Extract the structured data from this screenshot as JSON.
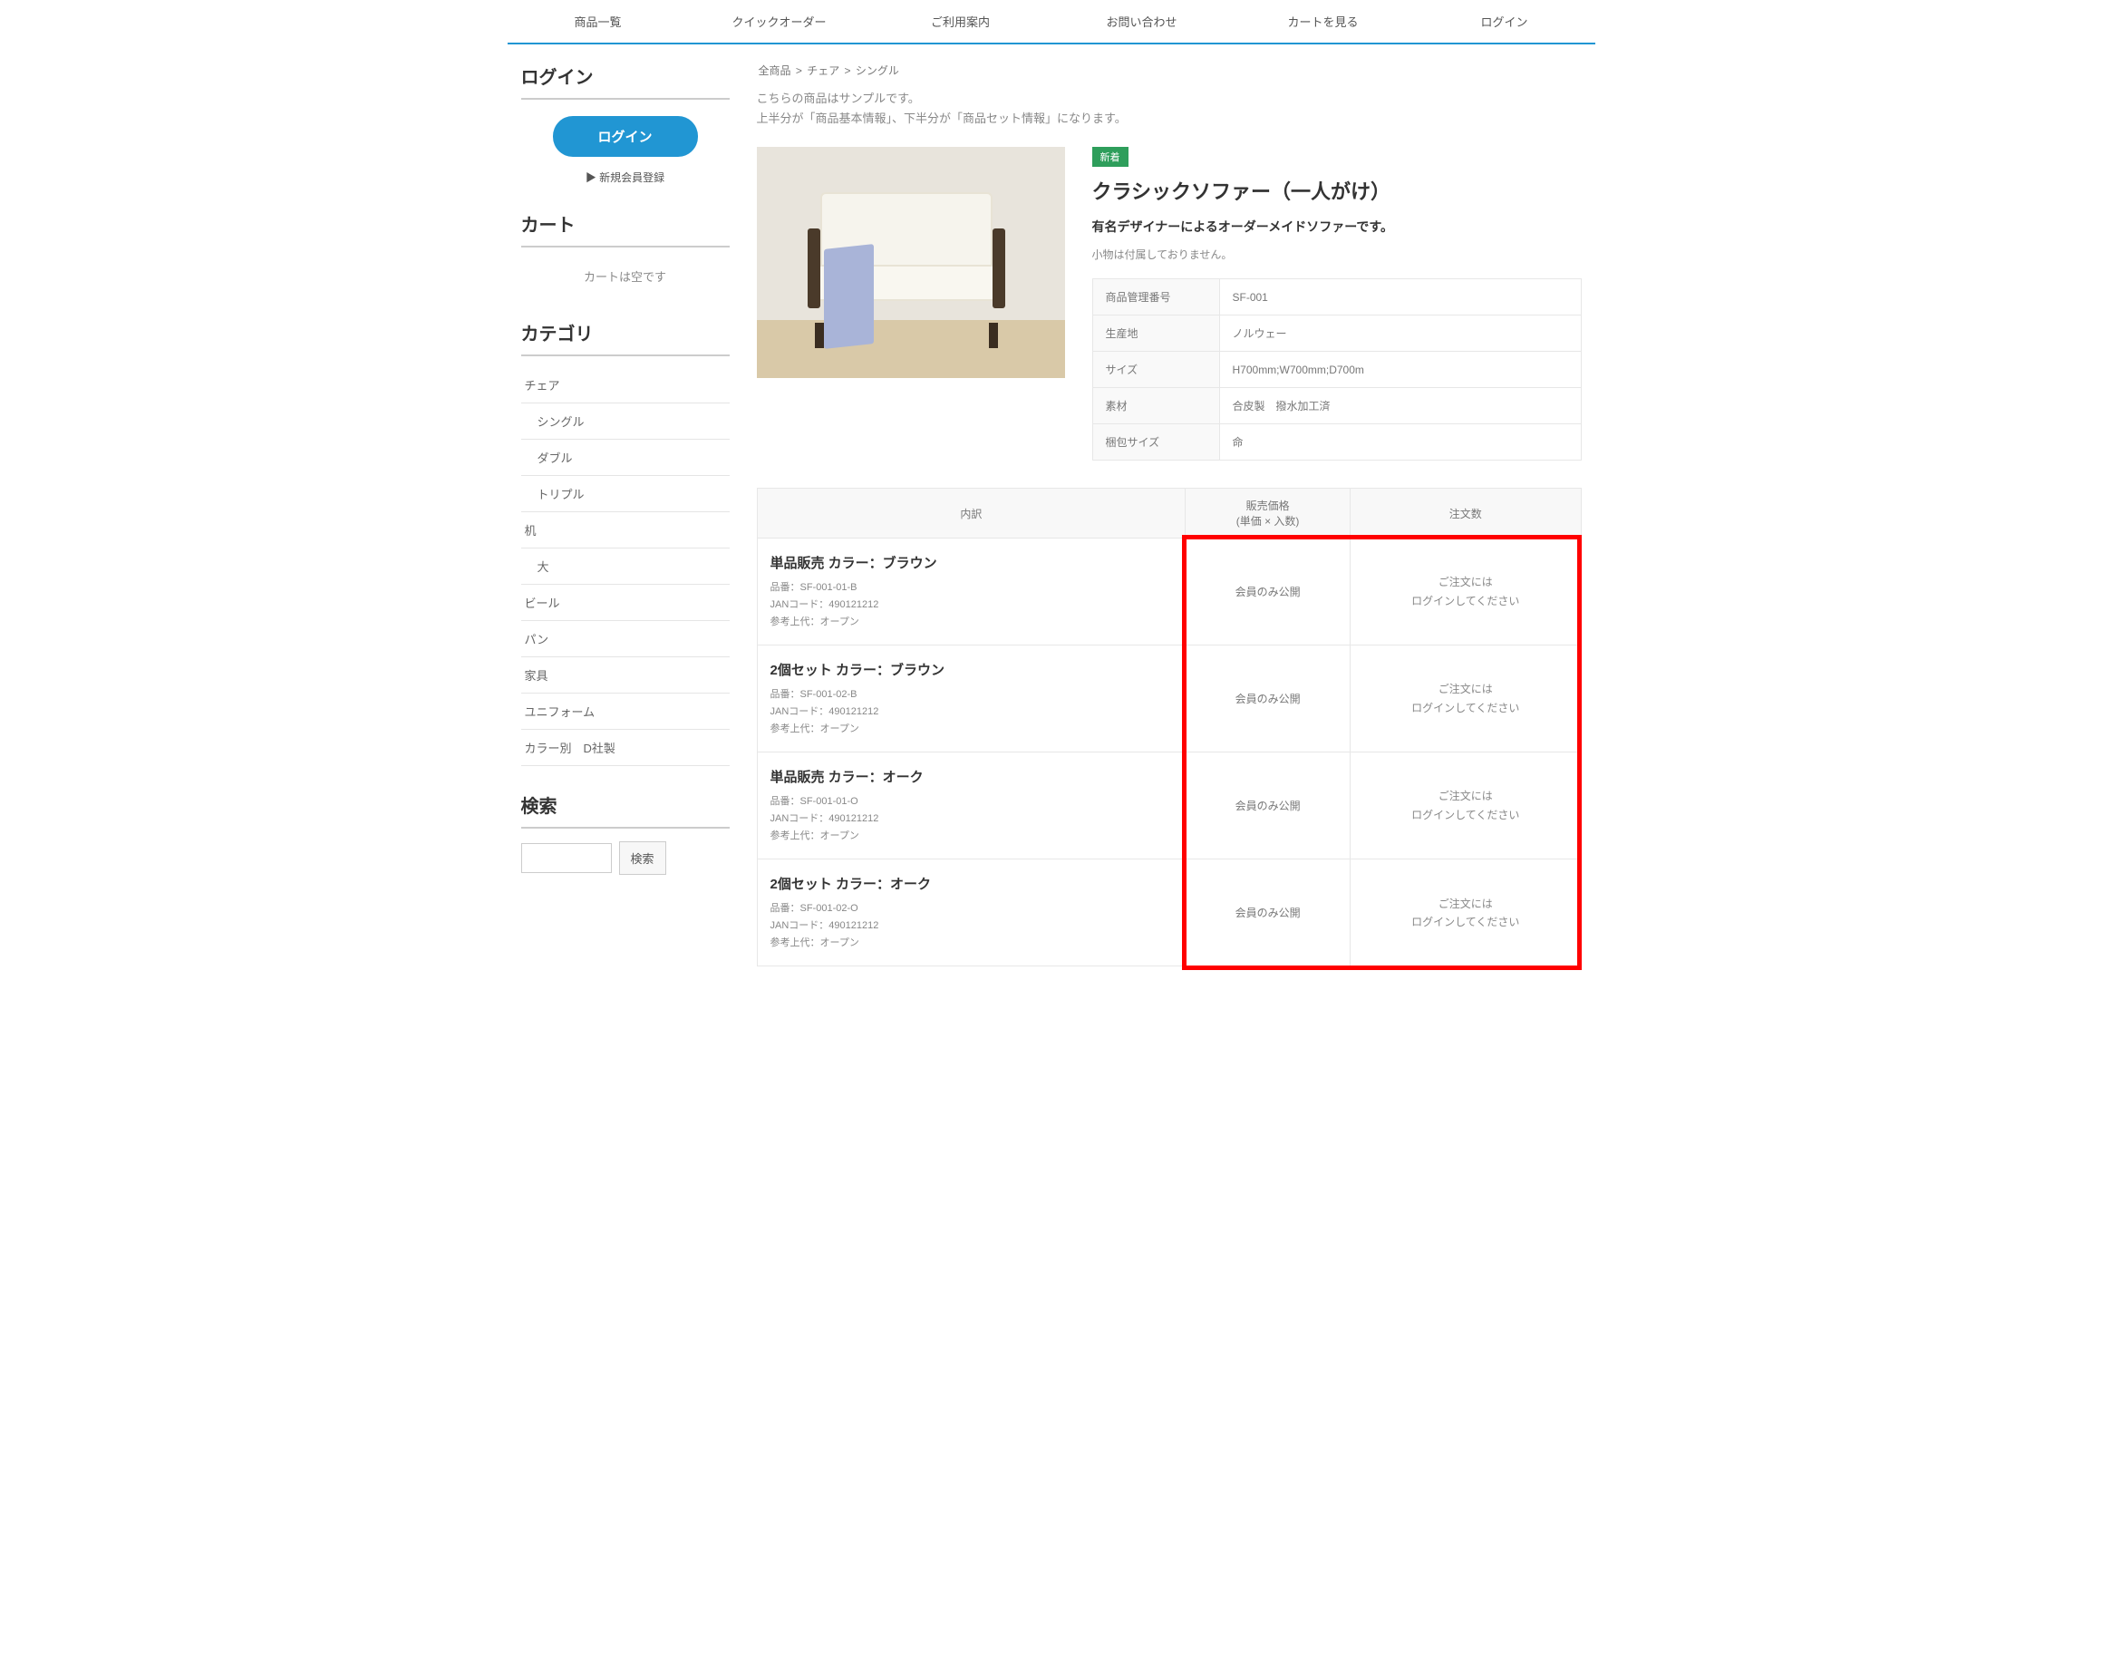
{
  "nav": [
    "商品一覧",
    "クイックオーダー",
    "ご利用案内",
    "お問い合わせ",
    "カートを見る",
    "ログイン"
  ],
  "sidebar": {
    "login": {
      "title": "ログイン",
      "button": "ログイン",
      "register": "▶ 新規会員登録"
    },
    "cart": {
      "title": "カート",
      "empty": "カートは空です"
    },
    "category": {
      "title": "カテゴリ",
      "items": [
        {
          "label": "チェア",
          "sub": false
        },
        {
          "label": "シングル",
          "sub": true
        },
        {
          "label": "ダブル",
          "sub": true
        },
        {
          "label": "トリプル",
          "sub": true
        },
        {
          "label": "机",
          "sub": false
        },
        {
          "label": "大",
          "sub": true
        },
        {
          "label": "ビール",
          "sub": false
        },
        {
          "label": "パン",
          "sub": false
        },
        {
          "label": "家具",
          "sub": false
        },
        {
          "label": "ユニフォーム",
          "sub": false
        },
        {
          "label": "カラー別　D社製",
          "sub": false
        }
      ]
    },
    "search": {
      "title": "検索",
      "button": "検索"
    }
  },
  "breadcrumb": [
    "全商品",
    "チェア",
    "シングル"
  ],
  "notice": {
    "line1": "こちらの商品はサンプルです。",
    "line2": "上半分が「商品基本情報」、下半分が「商品セット情報」になります。"
  },
  "product": {
    "badge": "新着",
    "title": "クラシックソファー（一人がけ）",
    "subtitle": "有名デザイナーによるオーダーメイドソファーです。",
    "desc": "小物は付属しておりません。",
    "specs": [
      {
        "label": "商品管理番号",
        "value": "SF-001"
      },
      {
        "label": "生産地",
        "value": "ノルウェー"
      },
      {
        "label": "サイズ",
        "value": "H700mm;W700mm;D700m"
      },
      {
        "label": "素材",
        "value": "合皮製　撥水加工済"
      },
      {
        "label": "梱包サイズ",
        "value": "命"
      }
    ]
  },
  "variantHeaders": {
    "breakdown": "内訳",
    "price": "販売価格",
    "priceSub": "(単価 × 入数)",
    "qty": "注文数"
  },
  "variants": [
    {
      "name": "単品販売 カラー：ブラウン",
      "meta": [
        "品番：SF-001-01-B",
        "JANコード：490121212",
        "参考上代：オープン"
      ],
      "price": "会員のみ公開",
      "qty1": "ご注文には",
      "qty2": "ログインしてください"
    },
    {
      "name": "2個セット カラー：ブラウン",
      "meta": [
        "品番：SF-001-02-B",
        "JANコード：490121212",
        "参考上代：オープン"
      ],
      "price": "会員のみ公開",
      "qty1": "ご注文には",
      "qty2": "ログインしてください"
    },
    {
      "name": "単品販売 カラー：オーク",
      "meta": [
        "品番：SF-001-01-O",
        "JANコード：490121212",
        "参考上代：オープン"
      ],
      "price": "会員のみ公開",
      "qty1": "ご注文には",
      "qty2": "ログインしてください"
    },
    {
      "name": "2個セット カラー：オーク",
      "meta": [
        "品番：SF-001-02-O",
        "JANコード：490121212",
        "参考上代：オープン"
      ],
      "price": "会員のみ公開",
      "qty1": "ご注文には",
      "qty2": "ログインしてください"
    }
  ]
}
